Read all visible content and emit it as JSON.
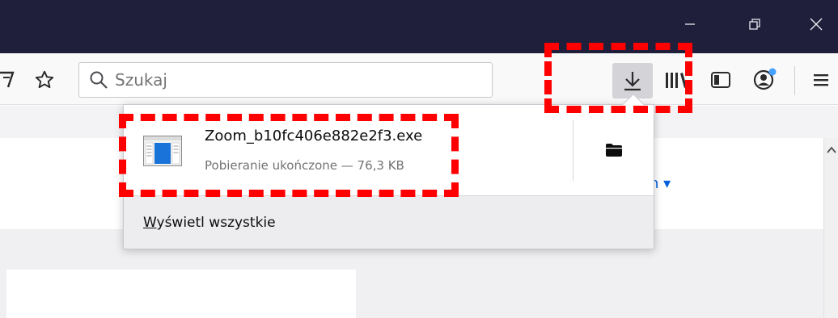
{
  "window": {
    "minimize_icon": "minimize-icon",
    "restore_icon": "restore-icon",
    "close_icon": "close-icon"
  },
  "toolbar": {
    "search": {
      "placeholder": "Szukaj"
    },
    "icons": [
      "reader-view-icon",
      "bookmark-star-icon",
      "download-icon",
      "library-icon",
      "sidebar-icon",
      "account-icon",
      "menu-icon"
    ]
  },
  "downloads_panel": {
    "items": [
      {
        "filename": "Zoom_b10fc406e882e2f3.exe",
        "status": "Pobieranie ukończone — 76,3 KB"
      }
    ],
    "show_all": {
      "prefix": "W",
      "rest": "yświetl wszystkie"
    }
  },
  "page": {
    "link_fragment": "h ▾"
  },
  "colors": {
    "titlebar": "#1f1f3b",
    "highlight": "#ff0000",
    "notification_dot": "#45a1ff"
  }
}
